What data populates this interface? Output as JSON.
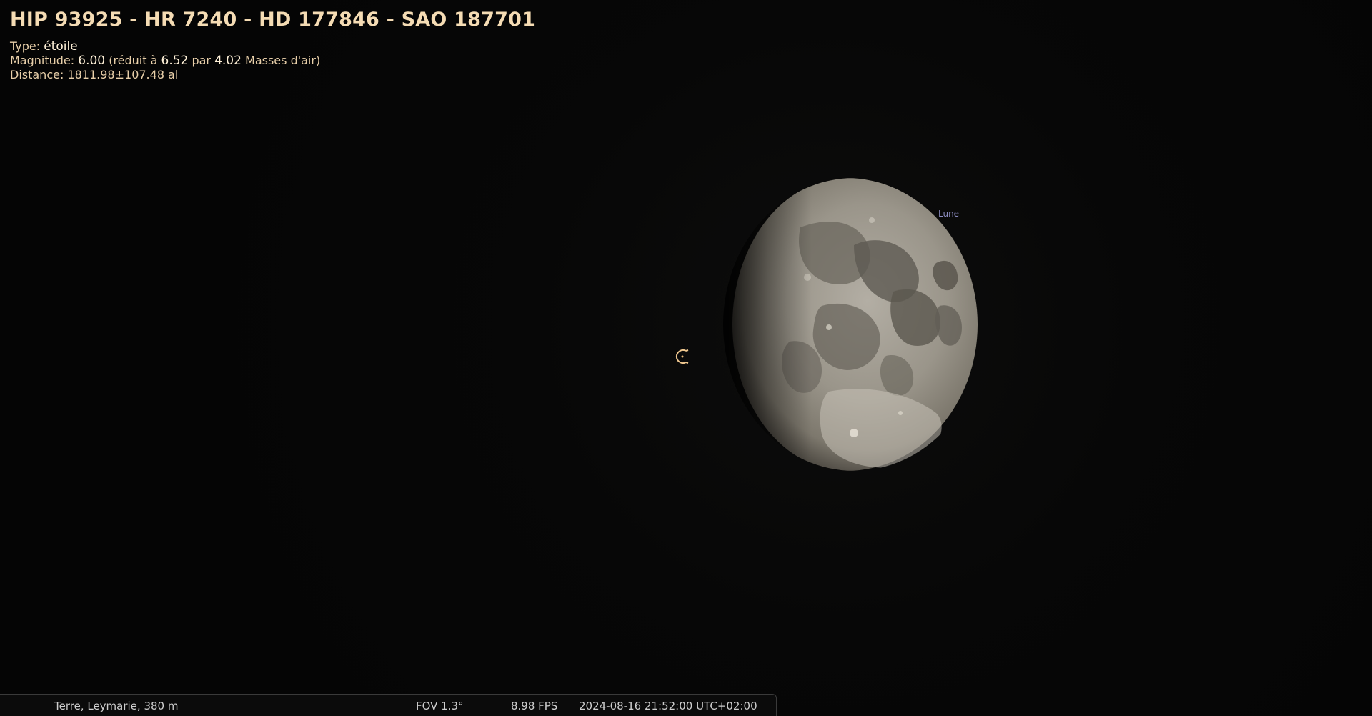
{
  "object_info": {
    "title": "HIP 93925 - HR 7240 - HD 177846 - SAO 187701",
    "type_label": "Type: ",
    "type_value": "étoile",
    "magnitude_label": "Magnitude: ",
    "magnitude_value": "6.00",
    "magnitude_reduced_prefix": " (réduit à ",
    "magnitude_reduced_value": "6.52",
    "magnitude_par": " par ",
    "airmass_value": "4.02",
    "airmass_suffix": " Masses d'air)",
    "distance_label": "Distance: ",
    "distance_value": "1811.98±107.48 al"
  },
  "sky": {
    "moon_label": "Lune",
    "moon_icon": "moon-gibbous-icon",
    "selection_marker_icon": "target-marker-icon"
  },
  "status_bar": {
    "location": "Terre, Leymarie, 380 m",
    "fov": "FOV 1.3°",
    "fps": "8.98 FPS",
    "datetime": "2024-08-16 21:52:00 UTC+02:00"
  },
  "colors": {
    "info_text": "#f5dcb4",
    "moon_label": "#8c8cc0",
    "background": "#060606"
  }
}
